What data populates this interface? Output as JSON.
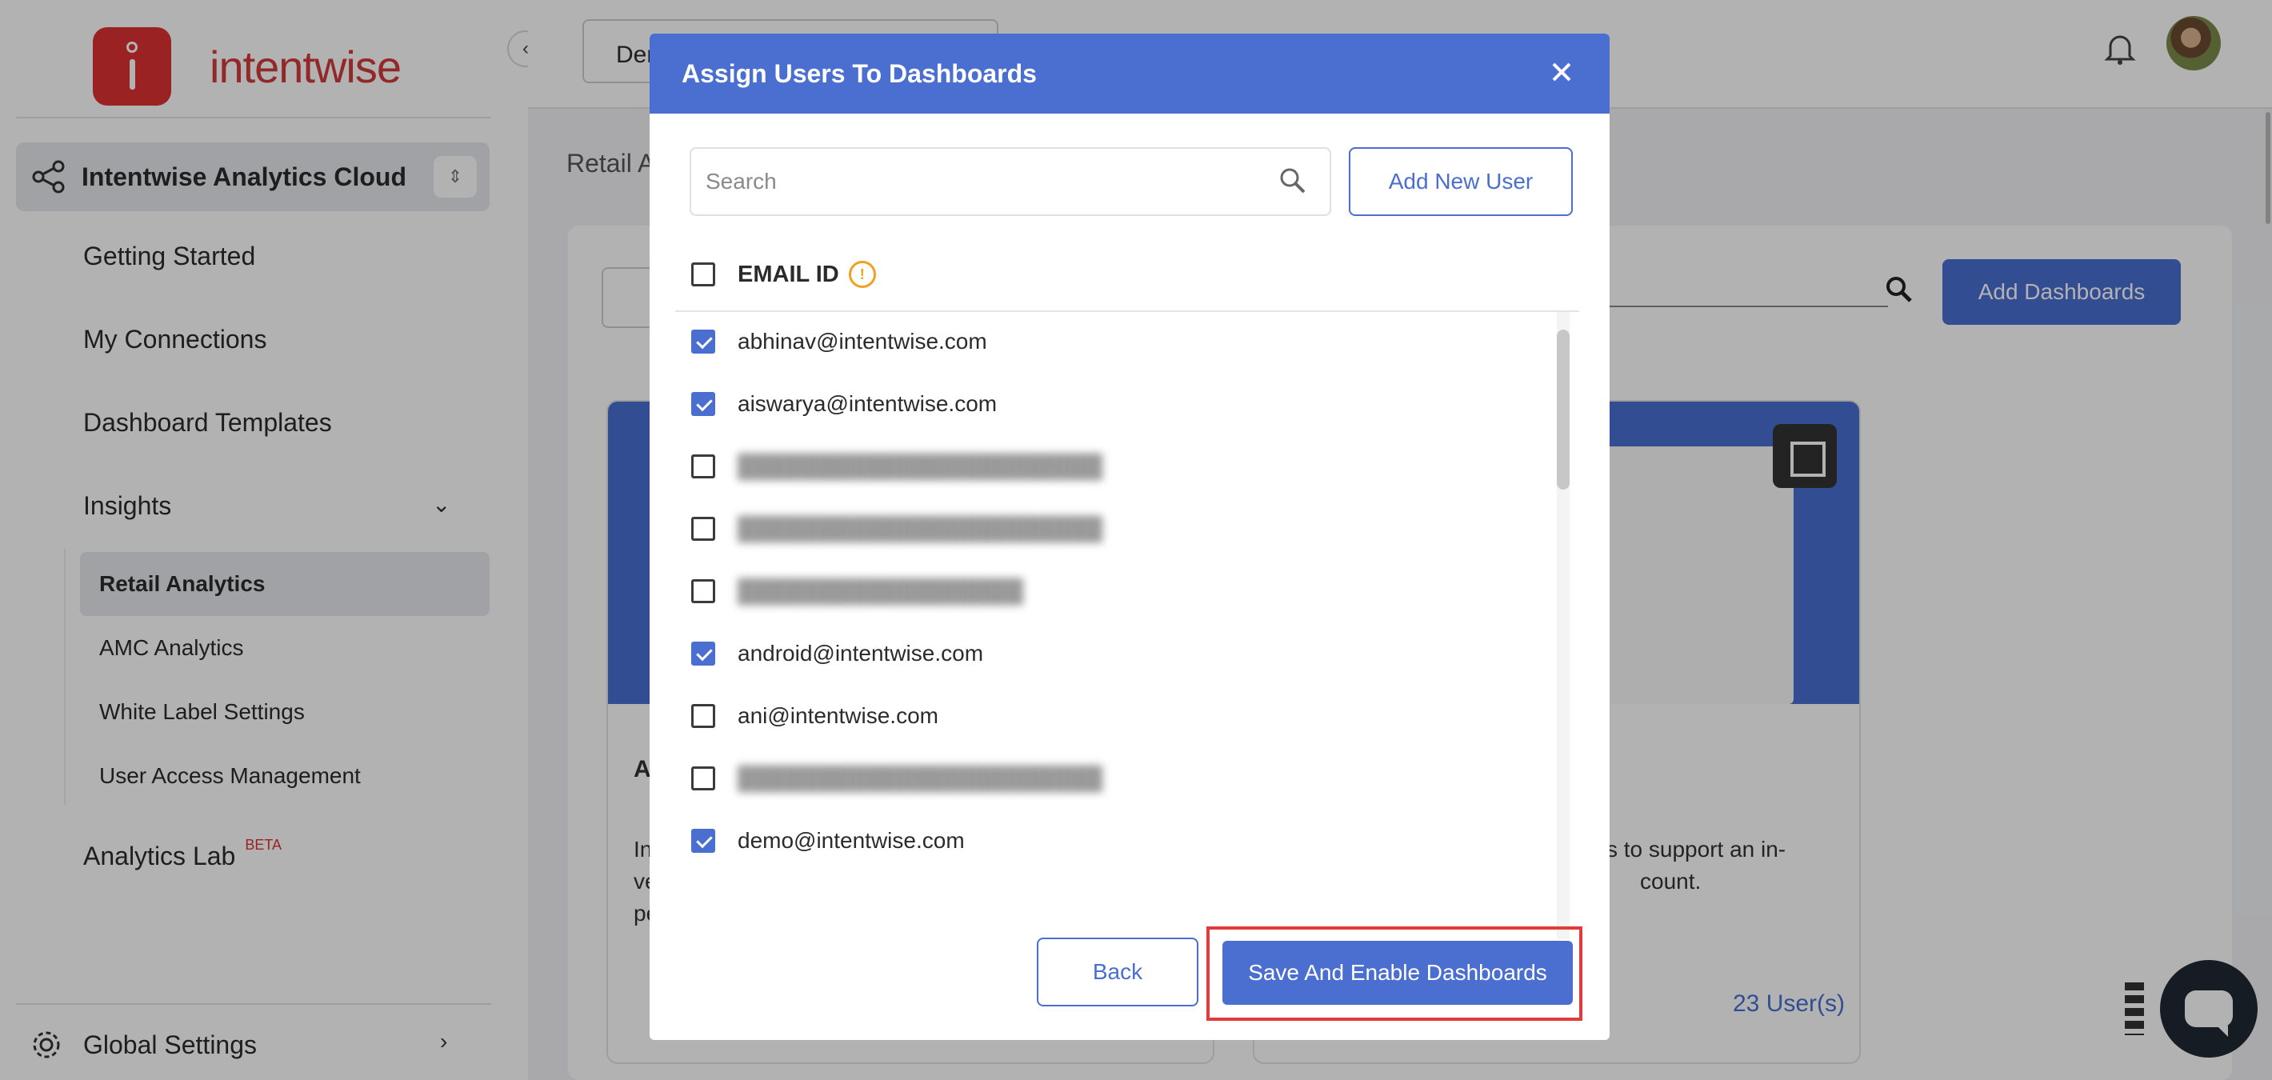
{
  "sidebar": {
    "brand": "intentwise",
    "workspace": "Intentwise Analytics Cloud",
    "nav": [
      {
        "label": "Getting Started"
      },
      {
        "label": "My Connections"
      },
      {
        "label": "Dashboard Templates"
      },
      {
        "label": "Insights"
      }
    ],
    "insights_items": [
      {
        "label": "Retail Analytics",
        "active": true
      },
      {
        "label": "AMC Analytics"
      },
      {
        "label": "White Label Settings"
      },
      {
        "label": "User Access Management"
      }
    ],
    "analytics_lab": "Analytics Lab",
    "beta_badge": "BETA",
    "global_settings": "Global Settings"
  },
  "topbar": {
    "client_select_value": "Der"
  },
  "page": {
    "breadcrumb": "Retail A",
    "add_dashboards_label": "Add Dashboards",
    "card_left": {
      "title": "A",
      "text_lines": [
        "In",
        "ve",
        "pe"
      ]
    },
    "card_right": {
      "text_lines": [
        "s to support an in-",
        "count."
      ],
      "users_link": "23 User(s)"
    }
  },
  "modal": {
    "title": "Assign Users To Dashboards",
    "search_placeholder": "Search",
    "add_new_user_label": "Add New User",
    "column_header": "EMAIL ID",
    "users": [
      {
        "email": "abhinav@intentwise.com",
        "checked": true,
        "blurred": false
      },
      {
        "email": "aiswarya@intentwise.com",
        "checked": true,
        "blurred": false
      },
      {
        "email": "",
        "checked": false,
        "blurred": true
      },
      {
        "email": "",
        "checked": false,
        "blurred": true
      },
      {
        "email": "",
        "checked": false,
        "blurred": true
      },
      {
        "email": "android@intentwise.com",
        "checked": true,
        "blurred": false
      },
      {
        "email": "ani@intentwise.com",
        "checked": false,
        "blurred": false
      },
      {
        "email": "",
        "checked": false,
        "blurred": true
      },
      {
        "email": "demo@intentwise.com",
        "checked": true,
        "blurred": false
      }
    ],
    "back_label": "Back",
    "save_label": "Save And Enable Dashboards"
  },
  "colors": {
    "accent": "#4a6fd1",
    "brand_red": "#dd3232",
    "highlight": "#e03c3c",
    "info_orange": "#f0a020"
  }
}
